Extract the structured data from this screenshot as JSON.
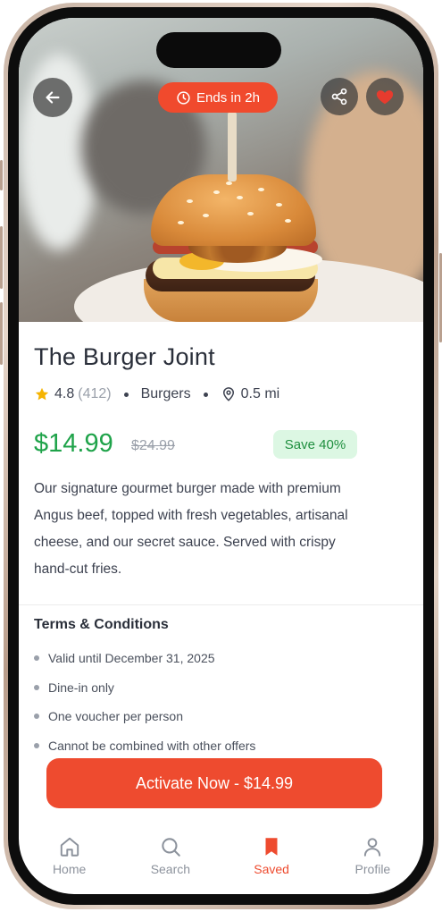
{
  "hero": {
    "countdown": "Ends in 2h",
    "icons": {
      "back": "arrow-left-icon",
      "share": "share-icon",
      "favorite": "heart-icon",
      "clock": "clock-icon"
    }
  },
  "deal": {
    "title": "The Burger Joint",
    "rating": "4.8",
    "reviews": "(412)",
    "category": "Burgers",
    "distance": "0.5 mi",
    "price": "$14.99",
    "original_price": "$24.99",
    "discount": "Save 40%",
    "description": "Our signature gourmet burger made with premium Angus beef, topped with fresh vegetables, artisanal cheese, and our secret sauce. Served with crispy hand-cut fries."
  },
  "terms": {
    "title": "Terms & Conditions",
    "items": [
      "Valid until December 31, 2025",
      "Dine-in only",
      "One voucher per person",
      "Cannot be combined with other offers"
    ]
  },
  "cta": {
    "label": "Activate Now - $14.99"
  },
  "tabbar": {
    "items": [
      {
        "label": "Home",
        "icon": "home-icon"
      },
      {
        "label": "Search",
        "icon": "search-icon"
      },
      {
        "label": "Saved",
        "icon": "bookmark-icon"
      },
      {
        "label": "Profile",
        "icon": "user-icon"
      }
    ],
    "active": "Saved"
  },
  "colors": {
    "accent": "#ee4b2f",
    "price_green": "#1fa34a",
    "save_badge_bg": "#dcf7e3",
    "rating_star": "#f5b301",
    "favorite_heart": "#e63b2e"
  }
}
